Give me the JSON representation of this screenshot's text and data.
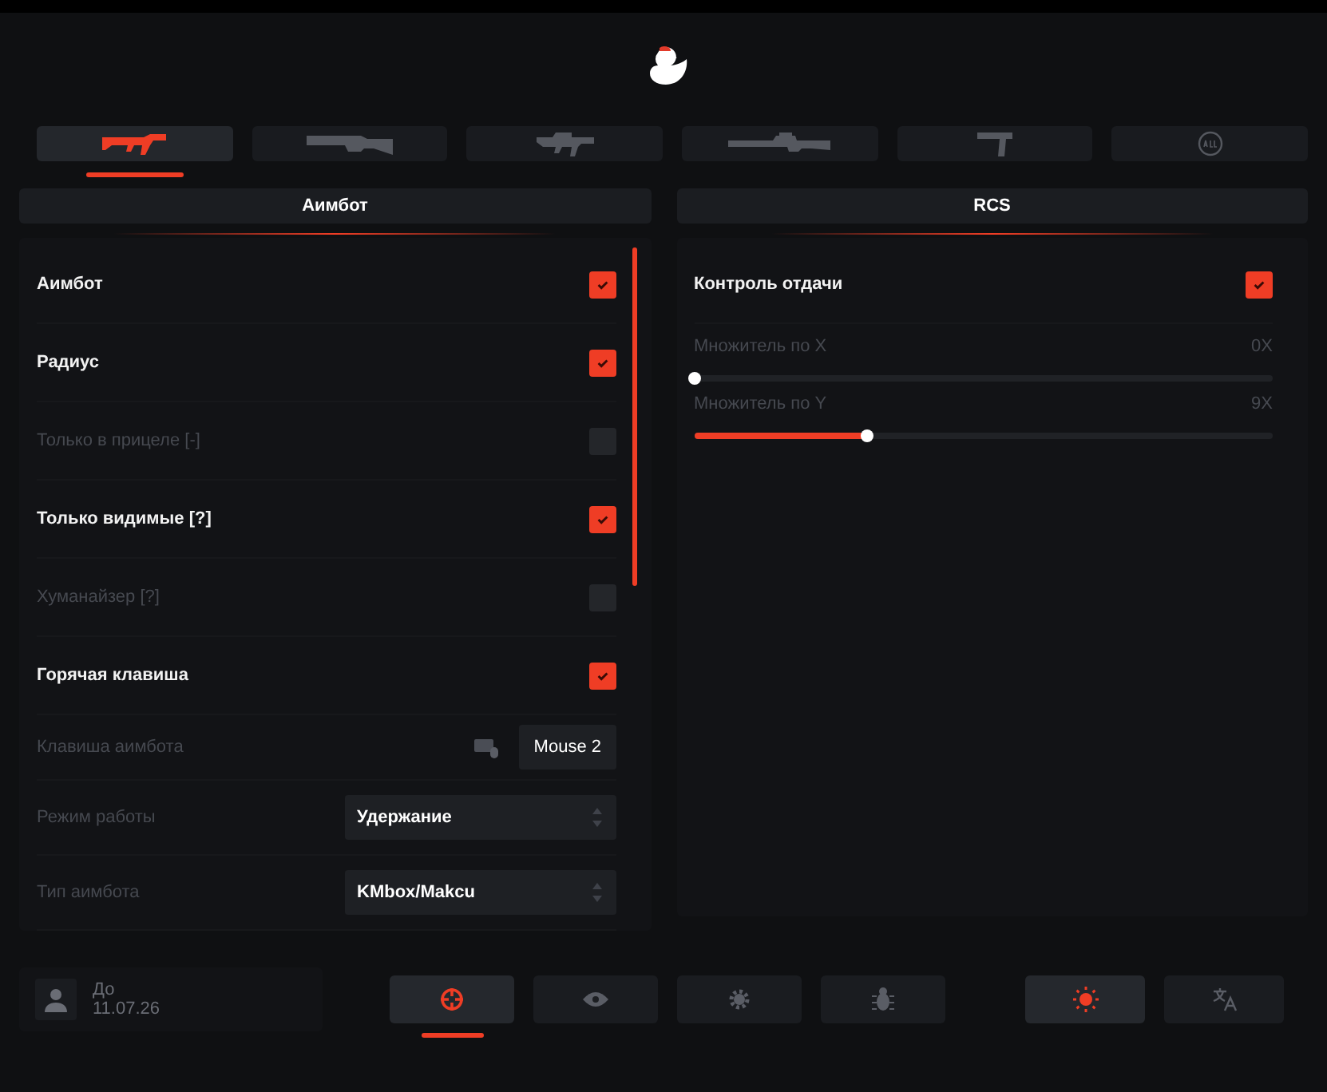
{
  "weapon_tabs": [
    {
      "kind": "rifle",
      "selected": true
    },
    {
      "kind": "shotgun",
      "selected": false
    },
    {
      "kind": "smg",
      "selected": false
    },
    {
      "kind": "sniper",
      "selected": false
    },
    {
      "kind": "pistol",
      "selected": false
    },
    {
      "kind": "all",
      "selected": false
    }
  ],
  "aimbot": {
    "title": "Аимбот",
    "rows": [
      {
        "kind": "checkbox",
        "label": "Аимбот",
        "checked": true
      },
      {
        "kind": "checkbox",
        "label": "Радиус",
        "checked": true
      },
      {
        "kind": "checkbox",
        "label": "Только в прицеле [-]",
        "checked": false
      },
      {
        "kind": "checkbox",
        "label": "Только видимые [?]",
        "checked": true
      },
      {
        "kind": "checkbox",
        "label": "Хуманайзер [?]",
        "checked": false
      },
      {
        "kind": "checkbox",
        "label": "Горячая клавиша",
        "checked": true
      },
      {
        "kind": "key",
        "label": "Клавиша аимбота",
        "value": "Mouse 2"
      },
      {
        "kind": "select",
        "label": "Режим работы",
        "value": "Удержание"
      },
      {
        "kind": "select",
        "label": "Тип аимбота",
        "value": "KMbox/Makcu"
      }
    ]
  },
  "rcs": {
    "title": "RCS",
    "rows": [
      {
        "kind": "checkbox",
        "label": "Контроль отдачи",
        "checked": true
      },
      {
        "kind": "slider",
        "label": "Множитель по X",
        "reading": "0X",
        "level": 0
      },
      {
        "kind": "slider",
        "label": "Множитель по Y",
        "reading": "9X",
        "level": 0.3
      }
    ]
  },
  "user": {
    "line_1": "До",
    "line_2": "11.07.26"
  },
  "nav_tabs": [
    {
      "kind": "crosshair",
      "selected": true
    },
    {
      "kind": "eye",
      "selected": false
    },
    {
      "kind": "gear",
      "selected": false
    },
    {
      "kind": "bug",
      "selected": false
    }
  ],
  "util_buttons": [
    {
      "kind": "sun",
      "selected": true
    },
    {
      "kind": "translate",
      "selected": false
    }
  ]
}
